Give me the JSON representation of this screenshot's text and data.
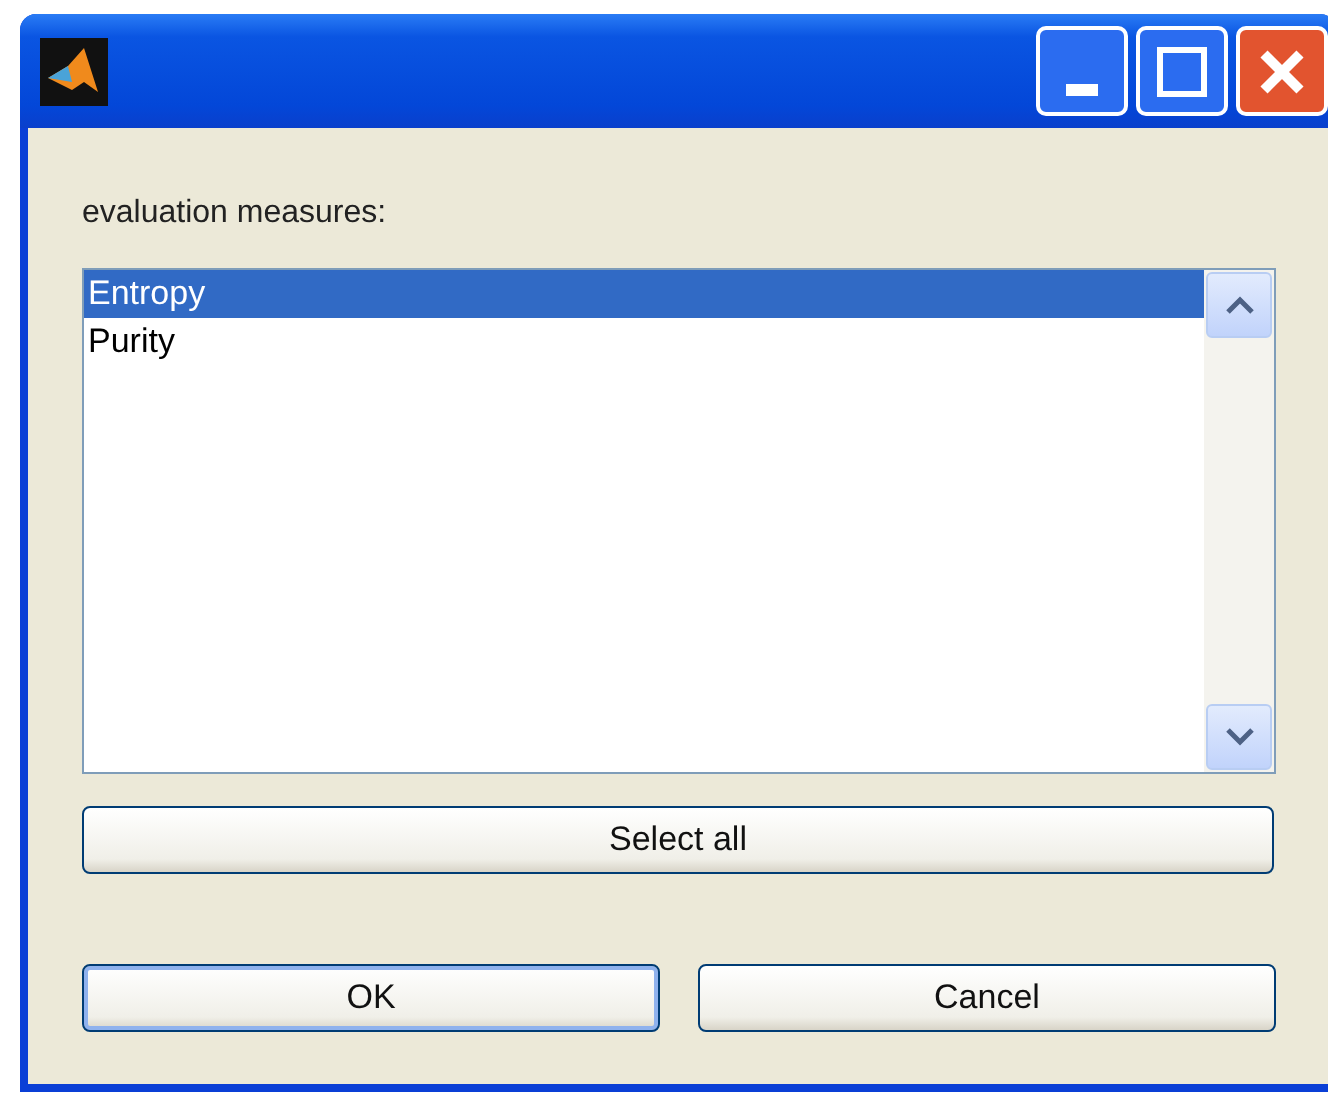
{
  "label": "evaluation measures:",
  "list": {
    "items": [
      {
        "text": "Entropy",
        "selected": true
      },
      {
        "text": "Purity",
        "selected": false
      }
    ]
  },
  "select_all_button": "Select all",
  "buttons": [
    {
      "label": "OK",
      "default": true
    },
    {
      "label": "Cancel",
      "default": false
    }
  ]
}
